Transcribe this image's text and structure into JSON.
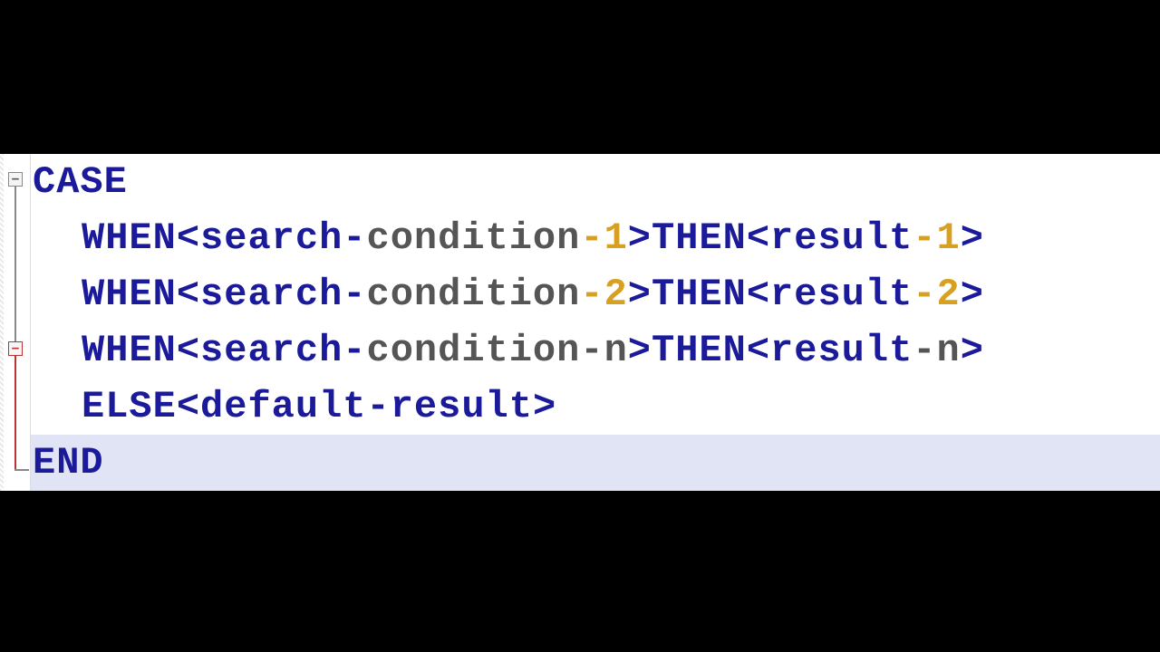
{
  "fold": {
    "box1_symbol": "−",
    "box2_symbol": "−"
  },
  "lines": {
    "l1_kw_case": "CASE",
    "l2_kw_when": "WHEN",
    "l2_lt": "<",
    "l2_search": "search",
    "l2_dash1": "-",
    "l2_cond": "condition",
    "l2_dash2": "-",
    "l2_num": "1",
    "l2_gt": ">",
    "l2_kw_then": "THEN",
    "l2_lt2": "<",
    "l2_result": "result",
    "l2_dash3": "-",
    "l2_num2": "1",
    "l2_gt2": ">",
    "l3_kw_when": "WHEN",
    "l3_lt": "<",
    "l3_search": "search",
    "l3_dash1": "-",
    "l3_cond": "condition",
    "l3_dash2": "-",
    "l3_num": "2",
    "l3_gt": ">",
    "l3_kw_then": "THEN",
    "l3_lt2": "<",
    "l3_result": "result",
    "l3_dash3": "-",
    "l3_num2": "2",
    "l3_gt2": ">",
    "l4_kw_when": "WHEN",
    "l4_lt": "<",
    "l4_search": "search",
    "l4_dash1": "-",
    "l4_cond": "condition",
    "l4_dash2": "-",
    "l4_n": "n",
    "l4_gt": ">",
    "l4_kw_then": "THEN",
    "l4_lt2": "<",
    "l4_result": "result",
    "l4_dash3": "-",
    "l4_n2": "n",
    "l4_gt2": ">",
    "l5_kw_else": "ELSE",
    "l5_lt": "<",
    "l5_default": "default",
    "l5_dash": "-",
    "l5_result": "result",
    "l5_gt": ">",
    "l6_kw_end": "END"
  }
}
